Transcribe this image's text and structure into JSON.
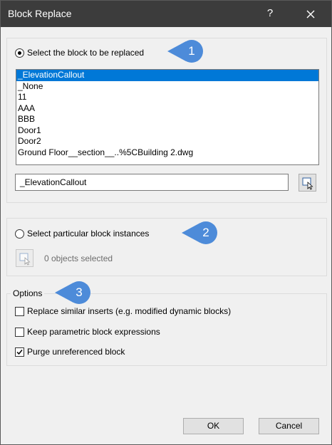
{
  "window": {
    "title": "Block Replace",
    "help_label": "?"
  },
  "section1": {
    "radio_label": "Select the block to be replaced",
    "badge": "1",
    "blocks": [
      "_ElevationCallout",
      "_None",
      "11",
      "AAA",
      "BBB",
      "Door1",
      "Door2",
      "Ground Floor__section__..%5CBuilding 2.dwg"
    ],
    "selected_block": "_ElevationCallout",
    "block_name_value": "_ElevationCallout"
  },
  "section2": {
    "radio_label": "Select particular block instances",
    "badge": "2",
    "objects_selected": "0 objects selected"
  },
  "options": {
    "legend": "Options",
    "badge": "3",
    "replace_similar": {
      "label": "Replace similar inserts (e.g. modified dynamic blocks)",
      "checked": false
    },
    "keep_parametric": {
      "label": "Keep parametric block expressions",
      "checked": false
    },
    "purge_unreferenced": {
      "label": "Purge unreferenced block",
      "checked": true
    }
  },
  "buttons": {
    "ok": "OK",
    "cancel": "Cancel"
  },
  "colors": {
    "titlebar": "#3c3c3c",
    "badge": "#4d8bd9",
    "selection": "#0078d7"
  },
  "icons": [
    "close-icon",
    "select-entities-icon",
    "checkmark-icon"
  ]
}
